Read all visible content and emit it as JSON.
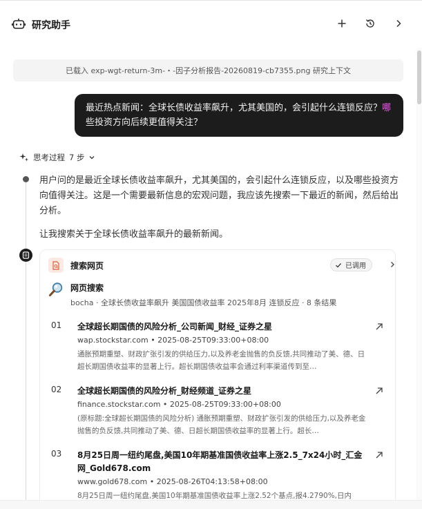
{
  "header": {
    "title": "研究助手",
    "icons": {
      "brand": "robot-icon",
      "add": "plus-icon",
      "history": "history-icon",
      "forward": "chevron-right-icon"
    }
  },
  "context_bar": {
    "text": "已载入 exp-wgt-return-3m-・-因子分析报告-20260819-cb7355.png 研究上下文"
  },
  "user_message": {
    "part1": "最近热点新闻：全球长债收益率飙升，尤其美国的，会引起什么连锁反应？",
    "part2": "哪",
    "part3": "些投资方向后续更值得关注？"
  },
  "thinking": {
    "label": "思考过程",
    "steps": "7 步",
    "text1": "用户问的是最近全球长债收益率飙升，尤其美国的，会引起什么连锁反应，以及哪些投资方向值得关注。这是一个需要最新信息的宏观问题，我应该先搜索一下最近的新闻，然后给出分析。",
    "text2": "让我搜索关于全球长债收益率飙升的最新新闻。"
  },
  "search_card": {
    "title": "搜索网页",
    "status": "已调用",
    "search_label": "网页搜索",
    "search_meta": "bocha · 全球长债收益率飙升 美国国债收益率 2025年8月 连锁反应 · 8 条结果",
    "results": [
      {
        "num": "01",
        "title": "全球超长期国债的风险分析_公司新闻_财经_证券之星",
        "meta": "wap.stockstar.com  •  2025-08-25T09:33:00+08:00",
        "snippet": "通胀预期重塑、财政扩张引发的供给压力,以及养老金抛售的负反馈,共同推动了美、德、日超长期国债收益率的显著上行。超长期国债收益率会通过利率渠道传到至…"
      },
      {
        "num": "02",
        "title": "全球超长期国债的风险分析_财经频道_证券之星",
        "meta": "finance.stockstar.com  •  2025-08-25T09:33:00+08:00",
        "snippet": "(原标题:全球超长期国债的风险分析) 通胀预期重塑、财政扩张引发的供给压力,以及养老金抛售的负反馈,共同推动了美、德、日超长期国债收益率的显著上行。超长…"
      },
      {
        "num": "03",
        "title": "8月25日周一纽约尾盘,美国10年期基准国债收益率上涨2.5_7x24小时_汇金网_Gold678.com",
        "meta": "www.gold678.com  •  2025-08-26T04:13:58+08:00",
        "snippet": "8月25日周一纽约尾盘,美国10年期基准国债收益率上涨2.52个基点,报4.2790%,日内"
      }
    ]
  },
  "colors": {
    "bubble_bg": "#1c1c1c",
    "highlight": "#d86bd8",
    "context_bg": "#f4f4f4"
  }
}
